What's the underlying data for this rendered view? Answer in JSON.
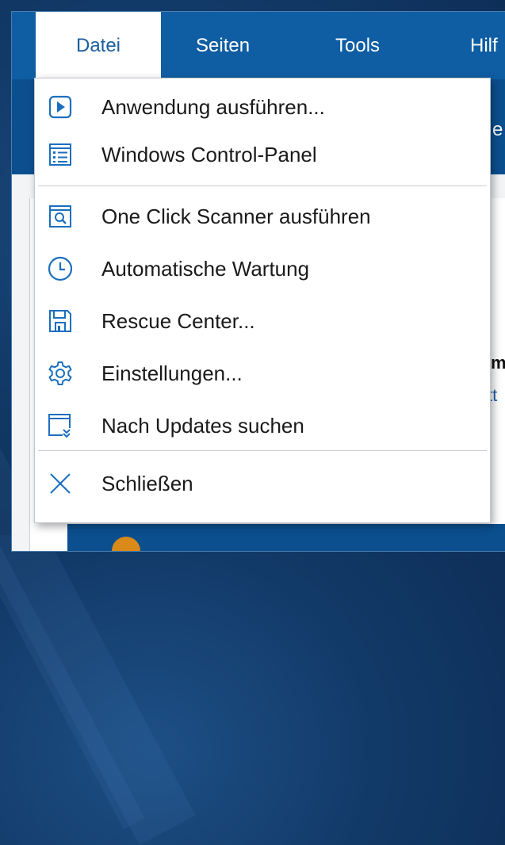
{
  "menubar": {
    "items": [
      {
        "label": "Datei",
        "active": true
      },
      {
        "label": "Seiten",
        "active": false
      },
      {
        "label": "Tools",
        "active": false
      },
      {
        "label": "Hilf",
        "active": false
      }
    ]
  },
  "background_fragments": {
    "toolbar_text": "e",
    "content_bold": "m",
    "content_link": "tt"
  },
  "menu": {
    "items": [
      {
        "label": "Anwendung ausführen...",
        "icon": "play-icon"
      },
      {
        "label": "Windows Control-Panel",
        "icon": "control-panel-icon"
      },
      {
        "label": "One Click Scanner ausführen",
        "icon": "scanner-icon"
      },
      {
        "label": "Automatische Wartung",
        "icon": "clock-icon"
      },
      {
        "label": "Rescue Center...",
        "icon": "save-disk-icon"
      },
      {
        "label": "Einstellungen...",
        "icon": "gear-icon"
      },
      {
        "label": "Nach Updates suchen",
        "icon": "update-icon"
      },
      {
        "label": "Schließen",
        "icon": "close-icon"
      }
    ]
  },
  "colors": {
    "accent": "#0f5ea3",
    "icon": "#1b6fbf",
    "menu_text": "#1a1a1a"
  }
}
